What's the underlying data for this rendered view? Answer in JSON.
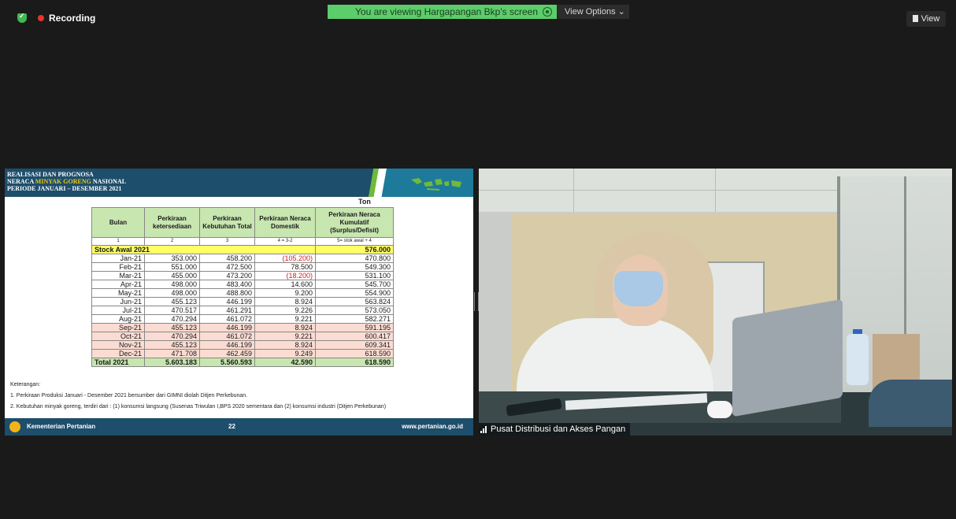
{
  "topbar": {
    "recording_label": "Recording",
    "sharing_text": "You are viewing Hargapangan Bkp's screen",
    "view_options_label": "View Options ⌄",
    "view_label": "View"
  },
  "slide": {
    "title_line1": "REALISASI DAN PROGNOSA",
    "title_line2_a": "NERACA ",
    "title_line2_b": "MINYAK GORENG",
    "title_line2_c": " NASIONAL",
    "title_line3": "PERIODE JANUARI – DESEMBER 2021",
    "unit": "Ton",
    "headers": [
      "Bulan",
      "Perkiraan ketersediaan",
      "Perkiraan Kebutuhan Total",
      "Perkiraan Neraca Domestik",
      "Perkiraan Neraca Kumulatif (Surplus/Defisit)"
    ],
    "index_row": [
      "1",
      "2",
      "3",
      "4 = 3-2",
      "5= stok awal + 4"
    ],
    "stock_label": "Stock Awal 2021",
    "stock_value": "576.000",
    "rows": [
      [
        "Jan-21",
        "353.000",
        "458.200",
        "(105.200)",
        "470.800"
      ],
      [
        "Feb-21",
        "551.000",
        "472.500",
        "78.500",
        "549.300"
      ],
      [
        "Mar-21",
        "455.000",
        "473.200",
        "(18.200)",
        "531.100"
      ],
      [
        "Apr-21",
        "498.000",
        "483.400",
        "14.600",
        "545.700"
      ],
      [
        "May-21",
        "498.000",
        "488.800",
        "9.200",
        "554.900"
      ],
      [
        "Jun-21",
        "455.123",
        "446.199",
        "8.924",
        "563.824"
      ],
      [
        "Jul-21",
        "470.517",
        "461.291",
        "9.226",
        "573.050"
      ],
      [
        "Aug-21",
        "470.294",
        "461.072",
        "9.221",
        "582.271"
      ],
      [
        "Sep-21",
        "455.123",
        "446.199",
        "8.924",
        "591.195"
      ],
      [
        "Oct-21",
        "470.294",
        "461.072",
        "9.221",
        "600.417"
      ],
      [
        "Nov-21",
        "455.123",
        "446.199",
        "8.924",
        "609.341"
      ],
      [
        "Dec-21",
        "471.708",
        "462.459",
        "9.249",
        "618.590"
      ]
    ],
    "total": [
      "Total 2021",
      "5.603.183",
      "5.560.593",
      "42.590",
      "618.590"
    ],
    "notes_title": "Keterangan:",
    "note1": "1.    Perkiraan Produksi Januari - Desember 2021 bersumber dari GIMNI diolah Ditjen Perkebunan.",
    "note2": "2.    Kebutuhan minyak goreng, terdiri dari : (1) konsumsi langsung (Susenas Triwulan I,BPS 2020 sementara dan (2) konsumsi industri (Ditjen Perkebunan)",
    "footer_org": "Kementerian Pertanian",
    "footer_page": "22",
    "footer_web": "www.pertanian.go.id"
  },
  "video": {
    "participant_name": "Pusat Distribusi dan Akses Pangan"
  }
}
